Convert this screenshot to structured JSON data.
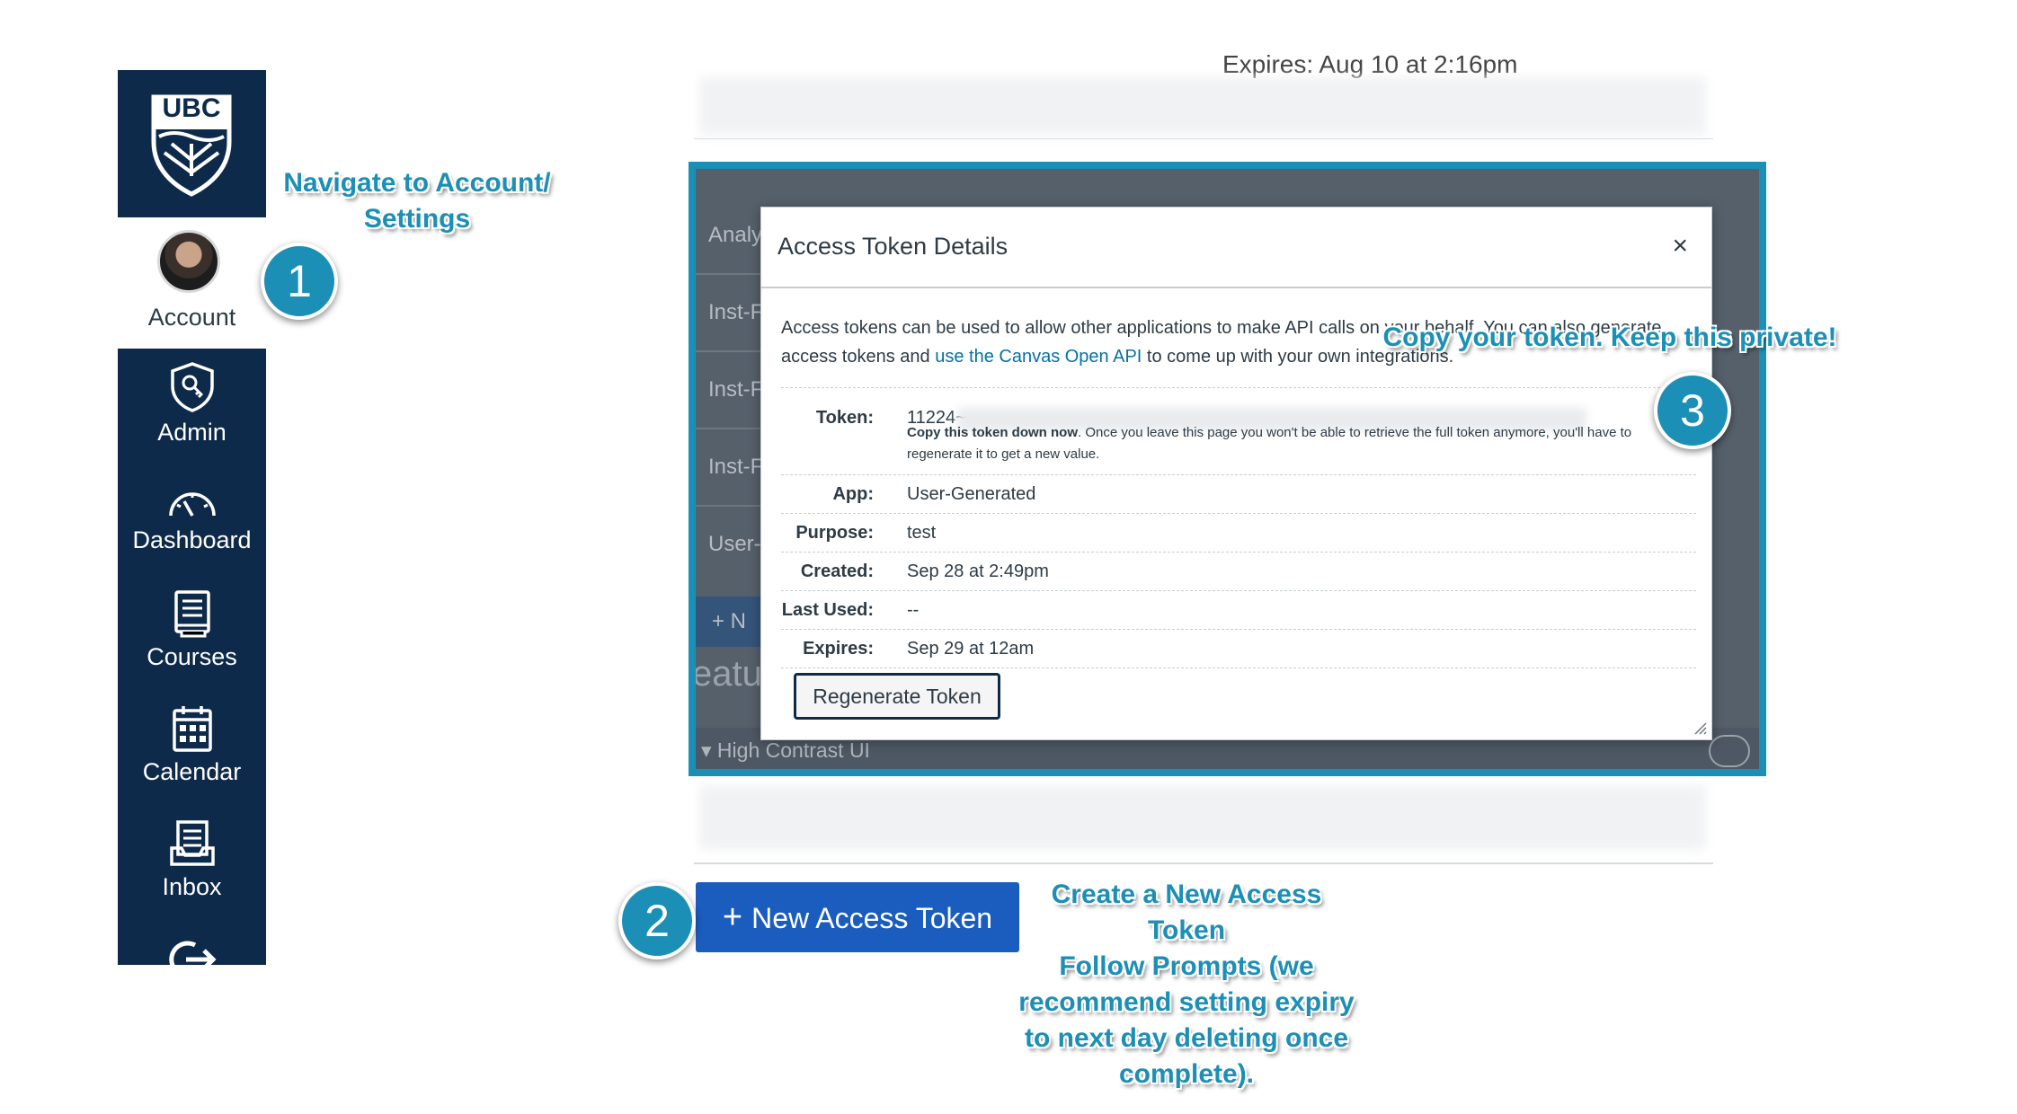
{
  "nav": {
    "logo_text": "UBC",
    "account": "Account",
    "items": [
      "Admin",
      "Dashboard",
      "Courses",
      "Calendar",
      "Inbox"
    ],
    "icons": [
      "shield-key-icon",
      "speedometer-icon",
      "book-icon",
      "calendar-icon",
      "inbox-icon",
      "logout-icon"
    ],
    "bg_color": "#0e2a4b"
  },
  "background": {
    "top_text": "Expires:     Aug 10 at 2:16pm",
    "left_rows": [
      "Analyt",
      "Inst-F",
      "Inst-F",
      "Inst-F",
      "User-C"
    ],
    "left_button": "+ N",
    "section": "eatu",
    "feature": "▾ High Contrast UI"
  },
  "modal": {
    "title": "Access Token Details",
    "close": "×",
    "description_a": "Access tokens can be used to allow other applications to make API calls on your behalf. You can also generate",
    "description_b": "access tokens and ",
    "description_link": "use the Canvas Open API",
    "description_c": " to come up with your own integrations.",
    "rows": [
      {
        "key": "Token:",
        "value": "11224~"
      },
      {
        "key": "App:",
        "value": "User-Generated"
      },
      {
        "key": "Purpose:",
        "value": "test"
      },
      {
        "key": "Created:",
        "value": "Sep 28 at 2:49pm"
      },
      {
        "key": "Last Used:",
        "value": "--"
      },
      {
        "key": "Expires:",
        "value": "Sep 29 at 12am"
      }
    ],
    "token_note_bold": "Copy this token down now",
    "token_note": ". Once you leave this page you won't be able to retrieve the full token anymore, you'll have to regenerate it to get a new value.",
    "regenerate": "Regenerate Token"
  },
  "new_token_button": {
    "icon": "plus-icon",
    "label": "New Access Token"
  },
  "steps": [
    "1",
    "2",
    "3"
  ],
  "callouts": {
    "navigate": "Navigate to Account/ Settings",
    "copy": "Copy your token. Keep this private!",
    "create_1": "Create a New Access",
    "create_2": "Token",
    "create_3": "Follow Prompts (we",
    "create_4": "recommend setting expiry",
    "create_5": "to next day  deleting once",
    "create_6": "complete)."
  },
  "colors": {
    "accent": "#1b8fb5",
    "button": "#1b5cbf",
    "link": "#0770a3"
  }
}
